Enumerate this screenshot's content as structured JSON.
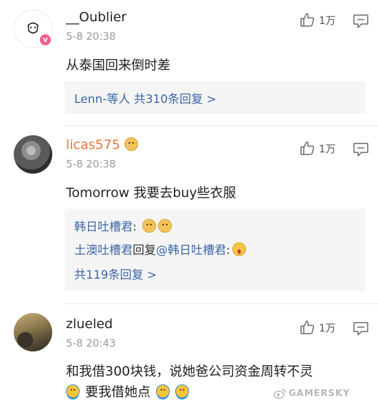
{
  "comments": [
    {
      "username": "__Oublier",
      "timestamp": "5-8 20:38",
      "text": "从泰国回来倒时差",
      "likes": "1万",
      "vip_badge": "v",
      "replies_summary": "Lenn-等人 共310条回复 >"
    },
    {
      "username": "licas575",
      "timestamp": "5-8 20:38",
      "text": "Tomorrow 我要去buy些衣服",
      "likes": "1万",
      "replies": [
        {
          "author": "韩日吐槽君",
          "sep": ":"
        },
        {
          "author": "土澳吐槽君",
          "mid": "回复",
          "mention": "@韩日吐槽君",
          "sep": ":"
        }
      ],
      "replies_total": "共119条回复 >"
    },
    {
      "username": "zlueled",
      "timestamp": "5-8 20:43",
      "text_line1": "和我借300块钱，说她爸公司资金周转不灵",
      "text_line2": "要我借她点",
      "likes": "1万"
    }
  ],
  "watermark": "GAMERSKY",
  "colors": {
    "link_blue": "#3c66a8",
    "orange_name": "#e8743b",
    "vip_pink": "#f4608a",
    "reply_bg": "#f5f5f5"
  },
  "icons": [
    "user-avatar-icon",
    "vip-badge-icon",
    "thumbs-up-icon",
    "comment-reply-icon",
    "emoji-cat-icon",
    "emoji-laugh-icon",
    "emoji-shrug-icon",
    "weibo-icon"
  ]
}
